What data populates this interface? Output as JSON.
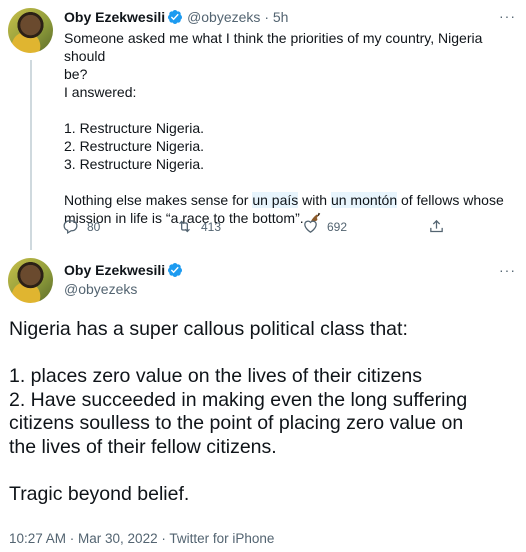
{
  "colors": {
    "accent": "#1d9bf0",
    "muted": "#536471",
    "text": "#0f1419"
  },
  "tweet1": {
    "name": "Oby Ezekwesili",
    "handle": "@obyezeks",
    "separator": "·",
    "time": "5h",
    "more": "···",
    "lines": [
      "Someone asked me what I think the priorities of my country, Nigeria should",
      "be?",
      "I answered:",
      "",
      "1. Restructure Nigeria.",
      "2. Restructure Nigeria.",
      "3. Restructure Nigeria.",
      ""
    ],
    "last_para": {
      "pre": "Nothing else makes sense for ",
      "hl1": "un país",
      "mid": " with ",
      "hl2": "un montón",
      "post": " of fellows whose",
      "line2": "mission in life is “a race to the bottom”. "
    },
    "reply_count": "80",
    "retweet_count": "413",
    "like_count": "692",
    "icons": [
      "reply-icon",
      "retweet-icon",
      "like-icon",
      "share-icon"
    ]
  },
  "tweet2": {
    "name": "Oby Ezekwesili",
    "handle": "@obyezeks",
    "more": "···",
    "lines": [
      "Nigeria has a super callous political class that:",
      "",
      "1. places zero value on the lives of their citizens",
      "2. Have succeeded in making even the long suffering",
      "citizens soulless to the point of placing zero value on",
      "the lives of their fellow citizens.",
      "",
      "Tragic beyond belief."
    ],
    "meta": "10:27 AM · Mar 30, 2022 · Twitter for iPhone"
  }
}
